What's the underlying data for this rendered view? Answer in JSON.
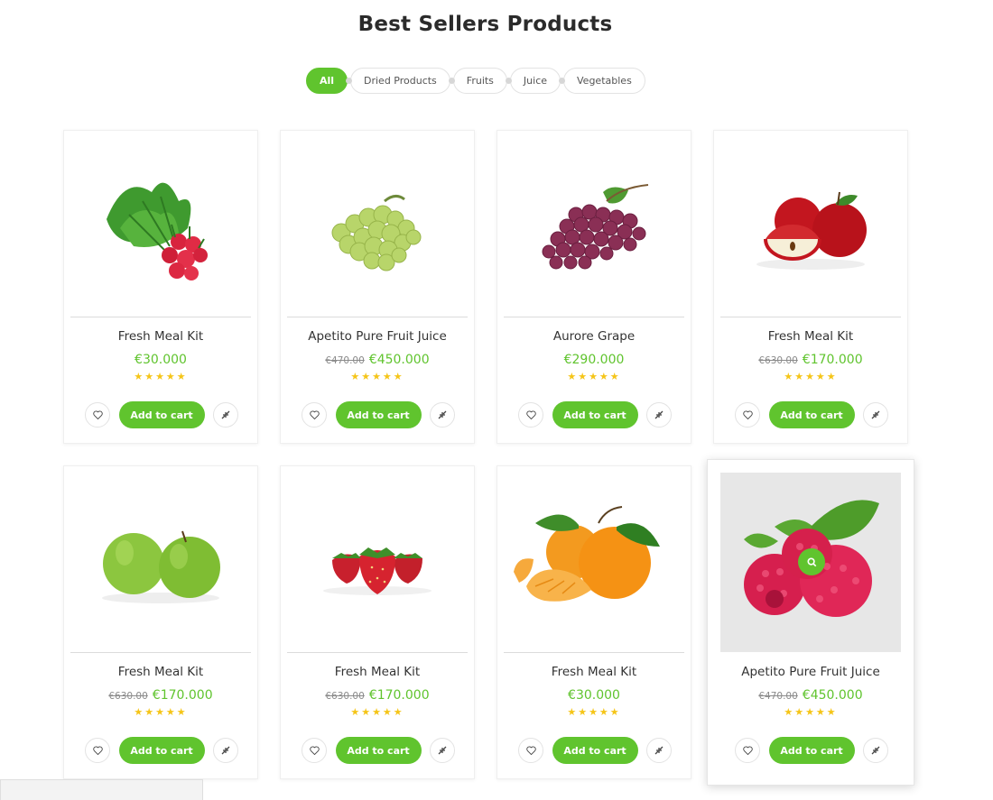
{
  "section": {
    "title": "Best Sellers Products"
  },
  "filters": [
    {
      "label": "All",
      "active": true
    },
    {
      "label": "Dried Products",
      "active": false
    },
    {
      "label": "Fruits",
      "active": false
    },
    {
      "label": "Juice",
      "active": false
    },
    {
      "label": "Vegetables",
      "active": false
    }
  ],
  "colors": {
    "accent": "#60c42e",
    "star": "#f5c518",
    "old_price": "#8a8a8a"
  },
  "products": [
    {
      "name": "Fresh Meal Kit",
      "old_price": "",
      "price": "€30.000",
      "rating": 5,
      "image": "radish",
      "cart_label": "Add to cart"
    },
    {
      "name": "Apetito Pure Fruit Juice",
      "old_price": "€470.00",
      "price": "€450.000",
      "rating": 5,
      "image": "green-grapes",
      "cart_label": "Add to cart"
    },
    {
      "name": "Aurore Grape",
      "old_price": "",
      "price": "€290.000",
      "rating": 5,
      "image": "red-grapes",
      "cart_label": "Add to cart"
    },
    {
      "name": "Fresh Meal Kit",
      "old_price": "€630.00",
      "price": "€170.000",
      "rating": 5,
      "image": "red-apples",
      "cart_label": "Add to cart"
    },
    {
      "name": "Fresh Meal Kit",
      "old_price": "€630.00",
      "price": "€170.000",
      "rating": 5,
      "image": "green-apples",
      "cart_label": "Add to cart"
    },
    {
      "name": "Fresh Meal Kit",
      "old_price": "€630.00",
      "price": "€170.000",
      "rating": 5,
      "image": "strawberries",
      "cart_label": "Add to cart"
    },
    {
      "name": "Fresh Meal Kit",
      "old_price": "",
      "price": "€30.000",
      "rating": 5,
      "image": "oranges",
      "cart_label": "Add to cart"
    },
    {
      "name": "Apetito Pure Fruit Juice",
      "old_price": "€470.00",
      "price": "€450.000",
      "rating": 5,
      "image": "raspberries",
      "cart_label": "Add to cart",
      "hovered": true
    }
  ],
  "icons": {
    "wishlist": "heart-icon",
    "compare": "compare-icon",
    "quick_view": "search-icon"
  }
}
